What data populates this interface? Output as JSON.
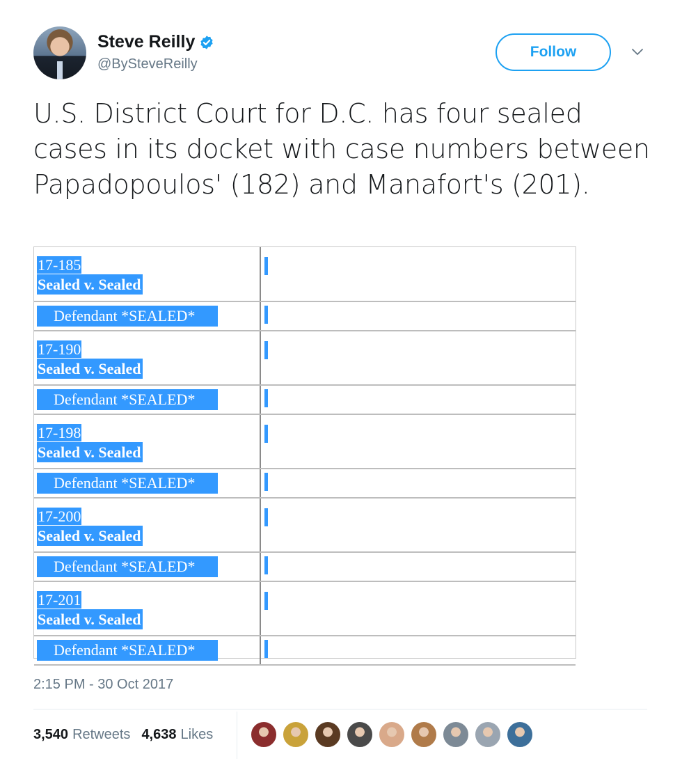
{
  "author": {
    "display_name": "Steve Reilly",
    "handle": "@BySteveReilly",
    "verified": true
  },
  "follow_button_label": "Follow",
  "tweet_text": "U.S. District Court for D.C. has four sealed cases in its docket with case numbers between Papadopoulos' (182) and Manafort's (201).",
  "docket": {
    "cases": [
      {
        "number": "17-185",
        "title": "Sealed v. Sealed",
        "defendant": "Defendant *SEALED*"
      },
      {
        "number": "17-190",
        "title": "Sealed v. Sealed",
        "defendant": "Defendant *SEALED*"
      },
      {
        "number": "17-198",
        "title": "Sealed v. Sealed",
        "defendant": "Defendant *SEALED*"
      },
      {
        "number": "17-200",
        "title": "Sealed v. Sealed",
        "defendant": "Defendant *SEALED*"
      },
      {
        "number": "17-201",
        "title": "Sealed v. Sealed",
        "defendant": "Defendant *SEALED*"
      }
    ]
  },
  "timestamp": "2:15 PM - 30 Oct 2017",
  "stats": {
    "retweets_count": "3,540",
    "retweets_label": "Retweets",
    "likes_count": "4,638",
    "likes_label": "Likes"
  },
  "liker_avatar_colors": [
    "#8b2d2d",
    "#c9a23a",
    "#5a3a22",
    "#4a4a4a",
    "#d9a98a",
    "#b07b4a",
    "#7d8a96",
    "#9aa5b1",
    "#3d6f9a"
  ],
  "colors": {
    "accent": "#1da1f2",
    "selection_highlight": "#3399ff",
    "secondary_text": "#657786"
  }
}
